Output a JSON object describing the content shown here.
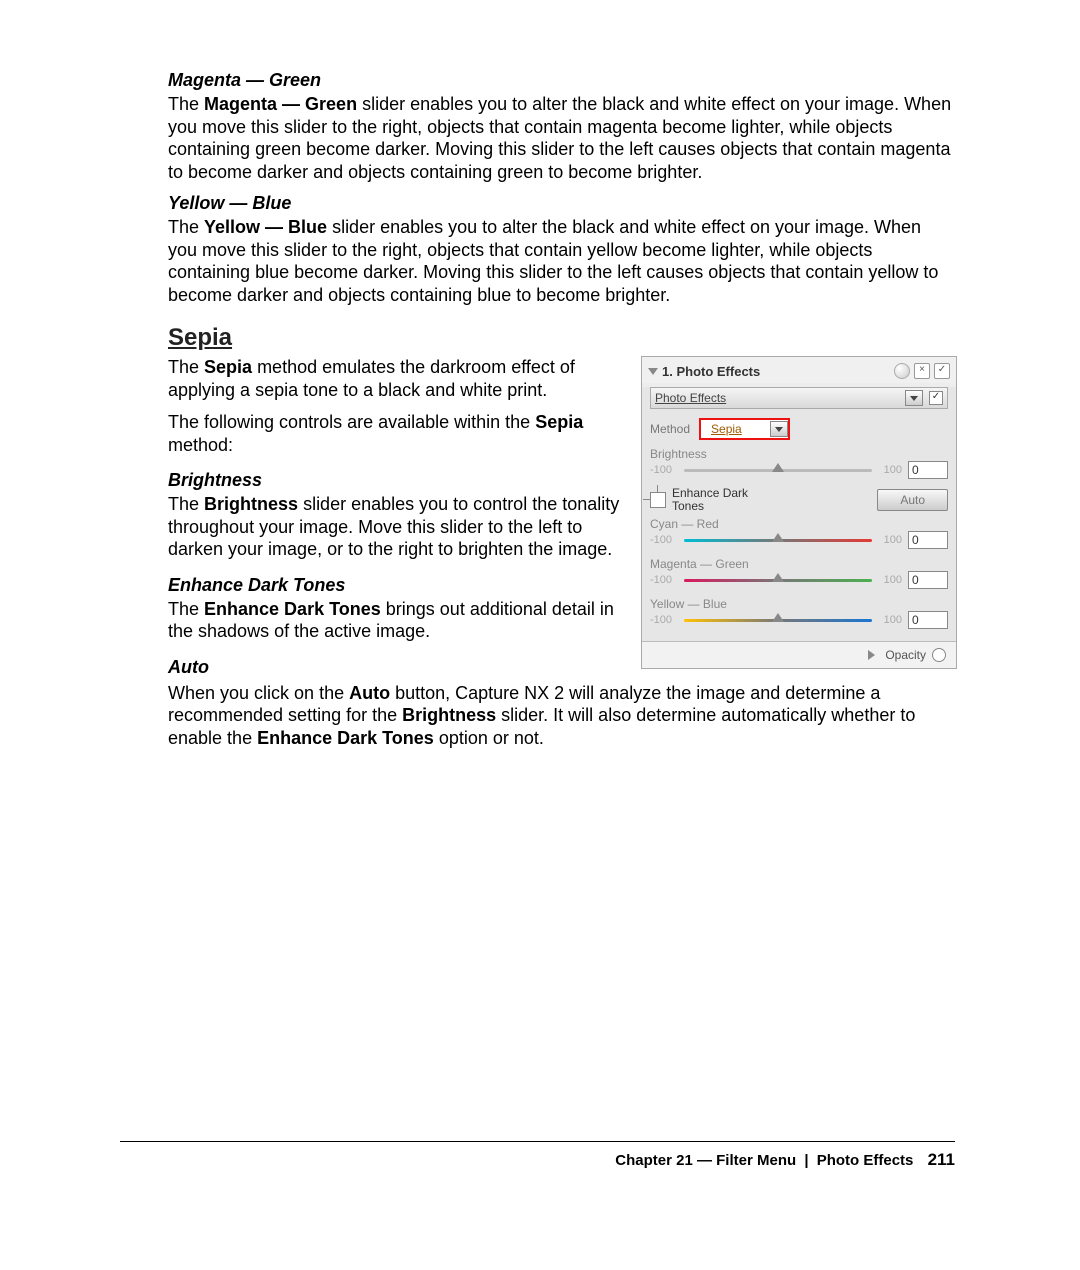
{
  "sections": {
    "magenta_green": {
      "heading": "Magenta — Green",
      "p_pre": "The ",
      "p_bold": "Magenta — Green",
      "p_post": " slider enables you to alter the black and white effect on your image. When you move this slider to the right, objects that contain magenta become lighter, while objects containing green become darker. Moving this slider to the left causes objects that contain magenta to become darker and objects containing green to become brighter."
    },
    "yellow_blue": {
      "heading": "Yellow — Blue",
      "p_pre": "The ",
      "p_bold": "Yellow — Blue",
      "p_post": " slider enables you to alter the black and white effect on your image. When you move this slider to the right, objects that contain yellow become lighter, while objects containing blue become darker. Moving this slider to the left causes objects that contain yellow to become darker and objects containing blue to become brighter."
    },
    "sepia": {
      "heading": "Sepia",
      "p1_pre": "The ",
      "p1_bold": "Sepia",
      "p1_post": " method emulates the darkroom effect of applying a sepia tone to a black and white print.",
      "p2_pre": "The following controls are available within the ",
      "p2_bold": "Sepia",
      "p2_post": " method:"
    },
    "brightness": {
      "heading": "Brightness",
      "p_pre": "The ",
      "p_bold": "Brightness",
      "p_post": " slider enables you to control the tonality throughout your image. Move this slider to the left to darken your image, or to the right to brighten the image."
    },
    "enhance": {
      "heading": "Enhance Dark Tones",
      "p_pre": "The ",
      "p_bold": "Enhance Dark Tones",
      "p_post": " brings out additional detail in the shadows of the active image."
    },
    "auto": {
      "heading": "Auto",
      "p_pre": "When you click on the ",
      "p_bold1": "Auto",
      "p_mid1": " button, Capture NX 2 will analyze the image and determine a recommended setting for the ",
      "p_bold2": "Brightness",
      "p_mid2": " slider. It will also determine automatically whether to enable the ",
      "p_bold3": "Enhance Dark Tones",
      "p_post": " option or not."
    }
  },
  "panel": {
    "title": "1. Photo Effects",
    "check_mark": "✓",
    "dropdown_label": "Photo Effects",
    "method_label": "Method",
    "method_value": "Sepia",
    "auto_button": "Auto",
    "enhance_label_l1": "Enhance Dark",
    "enhance_label_l2": "Tones",
    "opacity_label": "Opacity",
    "sliders": {
      "brightness": {
        "label": "Brightness",
        "min": "-100",
        "max": "100",
        "value": "0"
      },
      "cyan_red": {
        "label": "Cyan — Red",
        "min": "-100",
        "max": "100",
        "value": "0"
      },
      "mag_grn": {
        "label": "Magenta — Green",
        "min": "-100",
        "max": "100",
        "value": "0"
      },
      "yel_blu": {
        "label": "Yellow — Blue",
        "min": "-100",
        "max": "100",
        "value": "0"
      }
    }
  },
  "footer": {
    "chapter": "Chapter 21 — Filter Menu",
    "section": "Photo Effects",
    "page": "211"
  }
}
